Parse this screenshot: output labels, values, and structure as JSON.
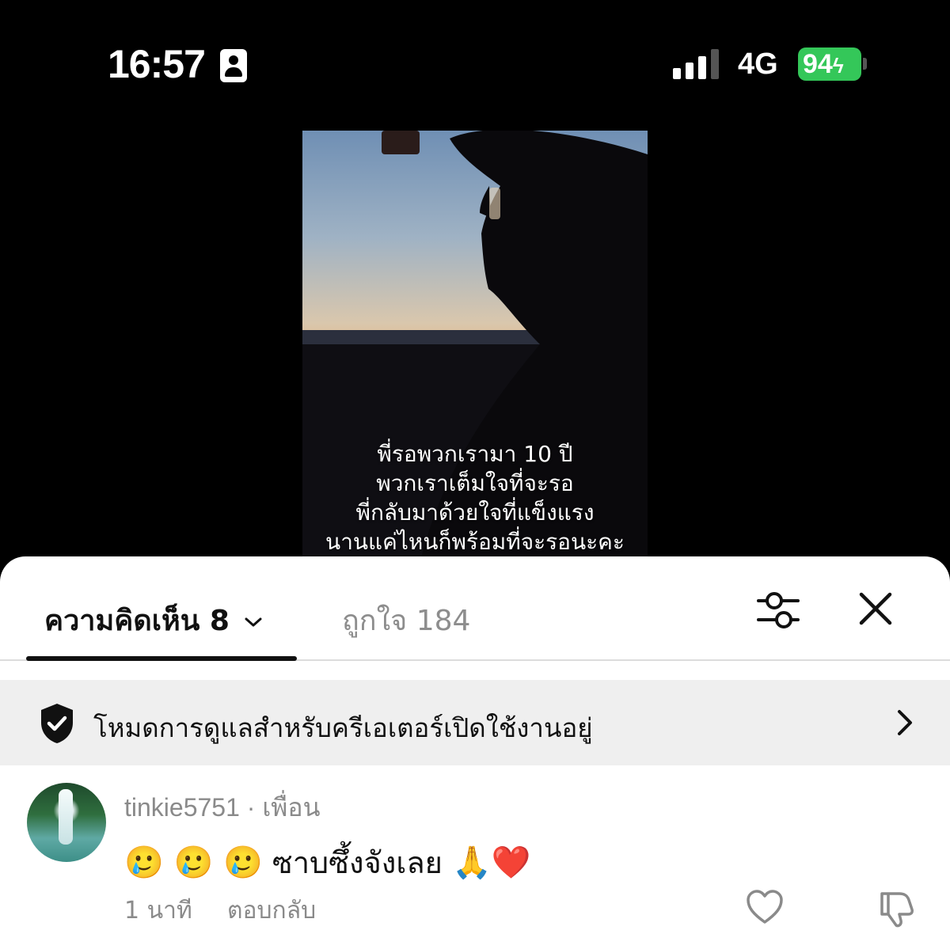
{
  "status_bar": {
    "time": "16:57",
    "network": "4G",
    "battery": "94",
    "battery_color": "#34c759",
    "icons": [
      "id-card-icon",
      "signal-icon",
      "battery-charging-icon"
    ]
  },
  "video": {
    "caption_lines": [
      "พี่รอพวกเรามา 10 ปี",
      "พวกเราเต็มใจที่จะรอ",
      "พี่กลับมาด้วยใจที่แข็งแรง",
      "นานแค่ไหนก็พร้อมที่จะรอนะคะ"
    ]
  },
  "sheet": {
    "tabs": {
      "comments_label": "ความคิดเห็น 8",
      "likes_label": "ถูกใจ 184"
    },
    "icons": [
      "chevron-down-icon",
      "filter-sliders-icon",
      "close-icon"
    ],
    "mode_banner": {
      "text": "โหมดการดูแลสำหรับครีเอเตอร์เปิดใช้งานอยู่",
      "icons": [
        "shield-check-icon",
        "chevron-right-icon"
      ]
    },
    "comments": [
      {
        "username": "tinkie5751",
        "tag": " · เพื่อน",
        "text": "🥲🥲🥲 ซาบซึ้งจังเลย 🙏❤️",
        "emoji_prefix": "🥲 🥲 🥲",
        "text_main": " ซาบซึ้งจังเลย ",
        "emoji_suffix": "🙏❤️",
        "time": "1 นาที",
        "reply_label": "ตอบกลับ",
        "icons": [
          "heart-icon",
          "dislike-icon"
        ]
      }
    ]
  }
}
